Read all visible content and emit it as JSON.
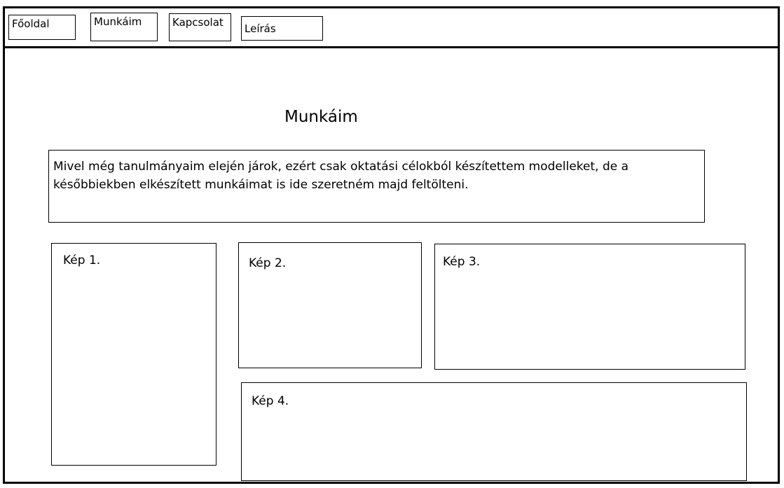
{
  "nav": {
    "items": [
      {
        "label": "Főoldal"
      },
      {
        "label": "Munkáim"
      },
      {
        "label": "Kapcsolat"
      },
      {
        "label": "Leírás"
      }
    ]
  },
  "main": {
    "title": "Munkáim",
    "intro": "Mivel még tanulmányaim elején járok, ezért csak oktatási célokból készítettem modelleket, de a későbbiekben elkészített munkáimat is ide szeretném majd feltölteni.",
    "images": [
      {
        "label": "Kép 1."
      },
      {
        "label": "Kép 2."
      },
      {
        "label": "Kép 3."
      },
      {
        "label": "Kép 4."
      }
    ]
  },
  "colors": {
    "border": "#000000",
    "background": "#ffffff"
  }
}
